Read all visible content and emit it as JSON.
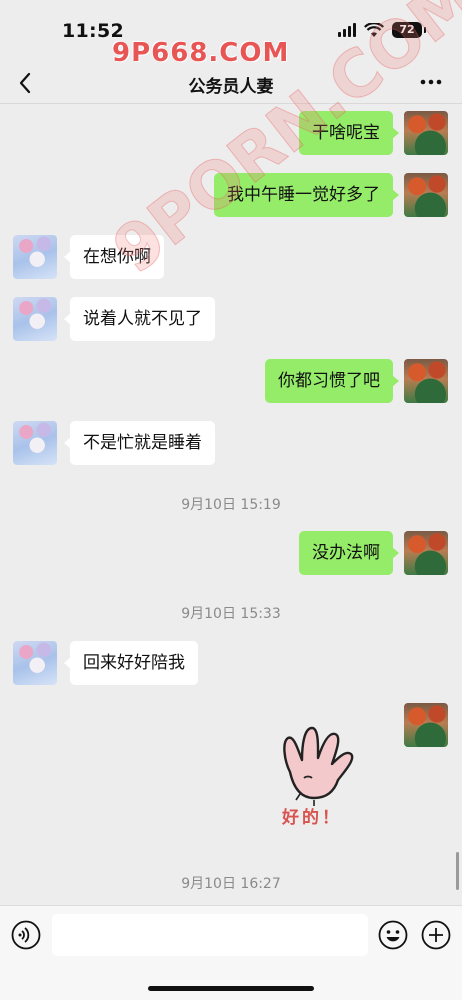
{
  "status_bar": {
    "time": "11:52",
    "battery": "72"
  },
  "watermark": {
    "top": "9P668.COM",
    "diagonal": "9PORN.COM"
  },
  "nav": {
    "title": "公务员人妻"
  },
  "messages": [
    {
      "sender": "me",
      "text": "干啥呢宝"
    },
    {
      "sender": "me",
      "text": "我中午睡一觉好多了"
    },
    {
      "sender": "other",
      "text": "在想你啊"
    },
    {
      "sender": "other",
      "text": "说着人就不见了"
    },
    {
      "sender": "me",
      "text": "你都习惯了吧"
    },
    {
      "sender": "other",
      "text": "不是忙就是睡着"
    },
    {
      "sender": "me",
      "text": "没办法啊"
    },
    {
      "sender": "other",
      "text": "回来好好陪我"
    }
  ],
  "timestamps": [
    "9月10日 15:19",
    "9月10日 15:33",
    "9月10日 16:27"
  ],
  "sticker": {
    "text": "好的！"
  },
  "input": {
    "value": "",
    "placeholder": ""
  }
}
